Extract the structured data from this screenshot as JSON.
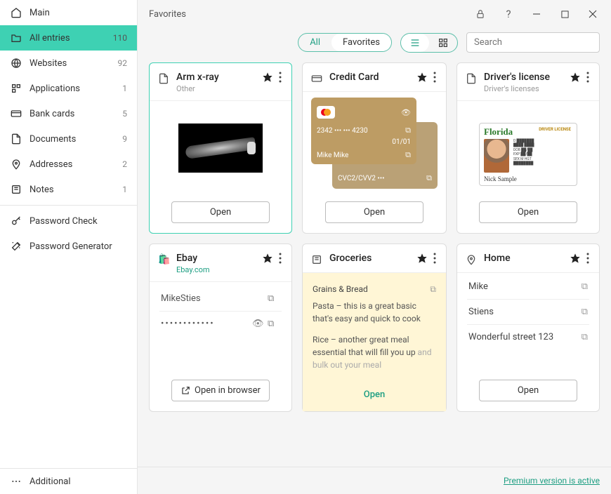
{
  "sidebar": {
    "main": "Main",
    "items": [
      {
        "label": "All entries",
        "count": "110"
      },
      {
        "label": "Websites",
        "count": "92"
      },
      {
        "label": "Applications",
        "count": "1"
      },
      {
        "label": "Bank cards",
        "count": "5"
      },
      {
        "label": "Documents",
        "count": "9"
      },
      {
        "label": "Addresses",
        "count": "2"
      },
      {
        "label": "Notes",
        "count": "1"
      }
    ],
    "tools": [
      {
        "label": "Password Check"
      },
      {
        "label": "Password Generator"
      }
    ],
    "bottom": "Additional"
  },
  "header": {
    "title": "Favorites"
  },
  "toolbar": {
    "filter_all": "All",
    "filter_fav": "Favorites",
    "search_placeholder": "Search"
  },
  "cards": {
    "xray": {
      "title": "Arm x-ray",
      "sub": "Other",
      "open": "Open"
    },
    "credit": {
      "title": "Credit Card",
      "number": "2342  ••• •••  4230",
      "exp": "01/01",
      "name": "Mike Mike",
      "cvv": "CVC2/CVV2  •••",
      "open": "Open"
    },
    "license": {
      "title": "Driver's license",
      "sub": "Driver's licenses",
      "state": "Florida",
      "dl": "DRIVER LICENSE",
      "sig": "Nick Sample",
      "open": "Open"
    },
    "ebay": {
      "title": "Ebay",
      "sub": "Ebay.com",
      "user": "MikeSties",
      "pass": "••••••••••••",
      "open": "Open in browser"
    },
    "groc": {
      "title": "Groceries",
      "heading": "Grains & Bread",
      "p1": "Pasta – this is a great basic that's easy and quick to cook",
      "p2a": "Rice – another great meal essential that will fill you up ",
      "p2b": "and bulk out your meal",
      "open": "Open"
    },
    "home": {
      "title": "Home",
      "rows": [
        "Mike",
        "Stiens",
        "Wonderful street 123"
      ],
      "open": "Open"
    }
  },
  "status": {
    "premium": "Premium version is active"
  }
}
